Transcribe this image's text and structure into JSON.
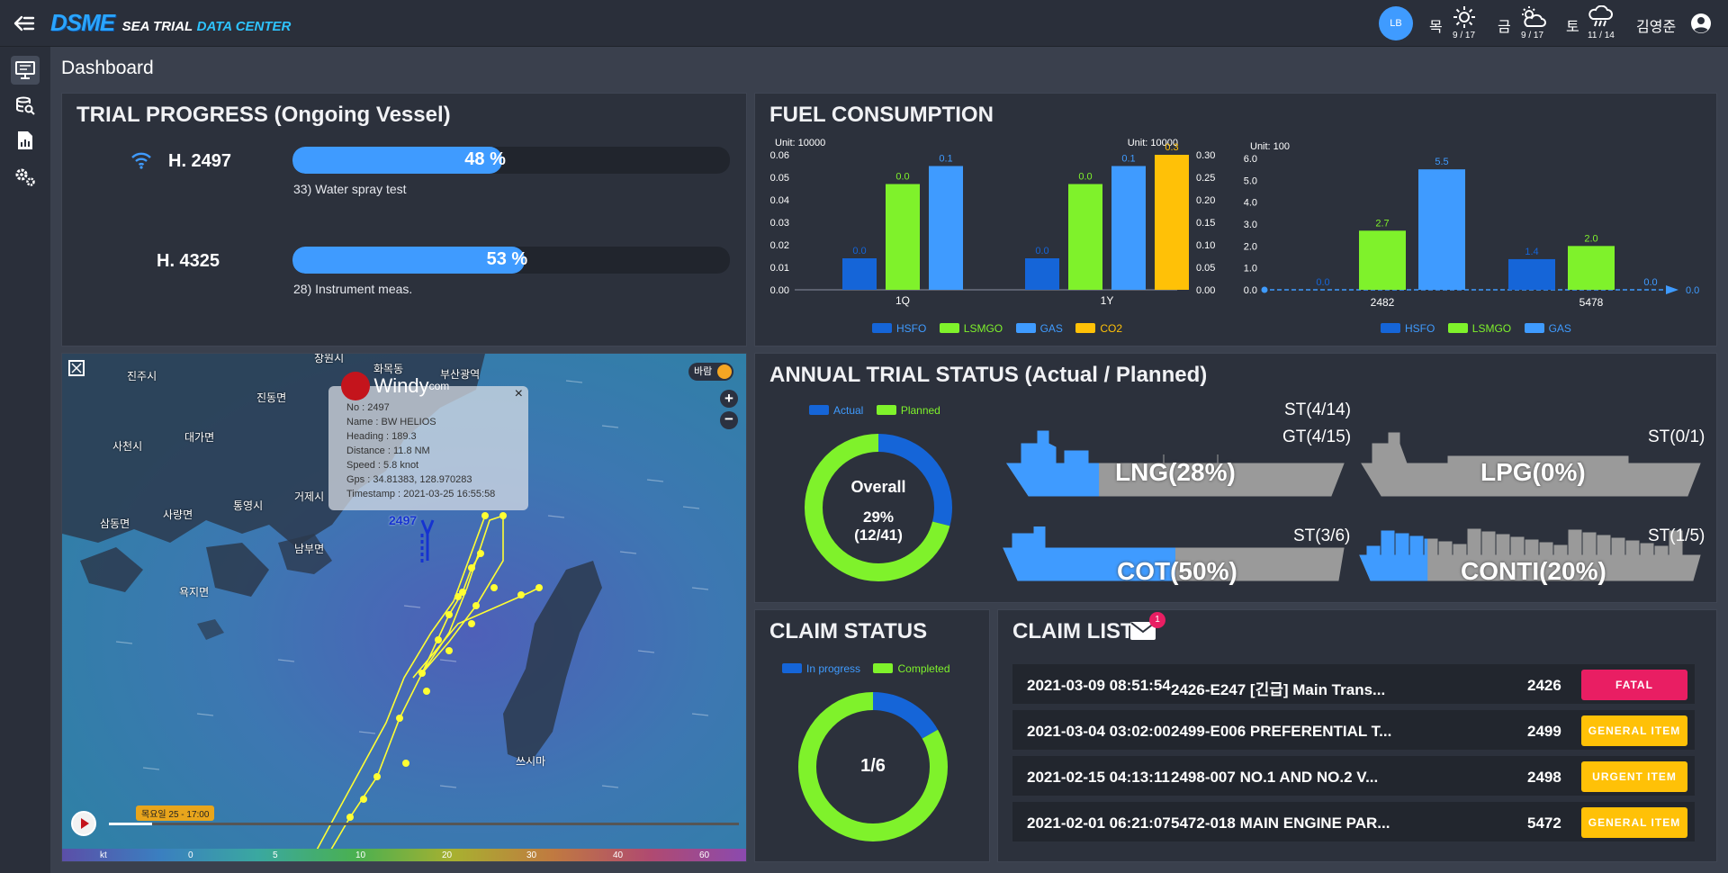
{
  "app": {
    "logo": "DSME",
    "title_part1": "SEA TRIAL",
    "title_part2": "DATA CENTER"
  },
  "header": {
    "avatar": "LB",
    "weather": [
      {
        "day": "목",
        "icon": "sun-icon",
        "value": "9 / 17"
      },
      {
        "day": "금",
        "icon": "partly-cloudy-icon",
        "value": "9 / 17"
      },
      {
        "day": "토",
        "icon": "rain-icon",
        "value": "11 / 14"
      }
    ],
    "user": "김영준"
  },
  "page": {
    "title": "Dashboard"
  },
  "trial_progress": {
    "title": "TRIAL PROGRESS (Ongoing Vessel)",
    "vessels": [
      {
        "name": "H. 2497",
        "percent_label": "48 %",
        "percent": 48,
        "step": "33) Water spray test",
        "live": true
      },
      {
        "name": "H. 4325",
        "percent_label": "53 %",
        "percent": 53,
        "step": "28) Instrument meas.",
        "live": false
      }
    ]
  },
  "fuel": {
    "title": "FUEL CONSUMPTION",
    "legend": [
      "HSFO",
      "LSMGO",
      "GAS",
      "CO2"
    ],
    "legend2": [
      "HSFO",
      "LSMGO",
      "GAS"
    ]
  },
  "chart_data": [
    {
      "type": "bar",
      "unit_left": "Unit: 10000",
      "unit_right": "Unit: 10000",
      "categories": [
        "1Q",
        "1Y"
      ],
      "yticks_left": [
        "0.06",
        "0.05",
        "0.04",
        "0.03",
        "0.02",
        "0.01",
        "0.00"
      ],
      "yticks_right": [
        "0.30",
        "0.25",
        "0.20",
        "0.15",
        "0.10",
        "0.05",
        "0.00"
      ],
      "ylim_left": [
        0,
        0.06
      ],
      "ylim_right": [
        0,
        0.3
      ],
      "series": [
        {
          "name": "HSFO",
          "values": [
            0.014,
            0.014
          ],
          "labels": [
            "0.0",
            "0.0"
          ],
          "color": "#1565d8"
        },
        {
          "name": "LSMGO",
          "values": [
            0.047,
            0.047
          ],
          "labels": [
            "0.0",
            "0.0"
          ],
          "color": "#7ff22b"
        },
        {
          "name": "GAS",
          "values": [
            0.055,
            0.055
          ],
          "labels": [
            "0.1",
            "0.1"
          ],
          "color": "#3f9bff"
        },
        {
          "name": "CO2",
          "values": [
            null,
            0.3
          ],
          "labels": [
            "",
            "0.3"
          ],
          "color": "#ffc107",
          "axis": "right"
        }
      ]
    },
    {
      "type": "bar",
      "unit": "Unit: 100",
      "categories": [
        "2482",
        "5478"
      ],
      "yticks": [
        "6.0",
        "5.0",
        "4.0",
        "3.0",
        "2.0",
        "1.0",
        "0.0"
      ],
      "ylim": [
        0,
        6
      ],
      "series": [
        {
          "name": "HSFO",
          "values": [
            0,
            1.4
          ],
          "labels": [
            "0.0",
            "1.4"
          ],
          "color": "#1565d8"
        },
        {
          "name": "LSMGO",
          "values": [
            2.7,
            2.0
          ],
          "labels": [
            "2.7",
            "2.0"
          ],
          "color": "#7ff22b"
        },
        {
          "name": "GAS",
          "values": [
            5.5,
            0
          ],
          "labels": [
            "5.5",
            "0.0"
          ],
          "color": "#3f9bff"
        }
      ],
      "end_label": "0.0"
    },
    {
      "type": "pie",
      "title": "Overall",
      "center_value": "29%",
      "center_sub": "(12/41)",
      "legend": [
        "Actual",
        "Planned"
      ],
      "values": [
        29,
        71
      ],
      "colors": [
        "#1565d8",
        "#7ff22b"
      ]
    },
    {
      "type": "pie",
      "center_value": "1/6",
      "legend": [
        "In progress",
        "Completed"
      ],
      "values": [
        16.7,
        83.3
      ],
      "colors": [
        "#1565d8",
        "#7ff22b"
      ]
    }
  ],
  "map": {
    "windy_logo": "Windy",
    "windy_suffix": "com",
    "wind_button": "바람",
    "popup": [
      "No : 2497",
      "Name : BW HELIOS",
      "Heading : 189.3",
      "Distance : 11.8 NM",
      "Speed : 5.8 knot",
      "Gps : 34.81383, 128.970283",
      "Timestamp : 2021-03-25 16:55:58"
    ],
    "vessel_label": "2497",
    "places": [
      "창원시",
      "화목동",
      "부산광역",
      "진주시",
      "진동면",
      "사천시",
      "대가면",
      "거제시",
      "통영시",
      "사량면",
      "삼동면",
      "남부면",
      "욕지면",
      "쓰시마"
    ],
    "timeline_label": "목요일 25 - 17:00",
    "scale": [
      "kt",
      "0",
      "5",
      "10",
      "20",
      "30",
      "40",
      "60"
    ]
  },
  "annual": {
    "title": "ANNUAL TRIAL STATUS (Actual / Planned)",
    "ships": [
      {
        "label": "LNG(28%)",
        "percent": 28,
        "st": "ST(4/14)",
        "gt": "GT(4/15)"
      },
      {
        "label": "LPG(0%)",
        "percent": 0,
        "st": "ST(0/1)"
      },
      {
        "label": "COT(50%)",
        "percent": 50,
        "st": "ST(3/6)"
      },
      {
        "label": "CONTI(20%)",
        "percent": 20,
        "st": "ST(1/5)"
      }
    ]
  },
  "claim_status": {
    "title": "CLAIM STATUS"
  },
  "claim_list": {
    "title": "CLAIM LIST",
    "badge_count": "1",
    "rows": [
      {
        "date": "2021-03-09 08:51:54",
        "desc": "2426-E247 [긴급] Main Trans...",
        "hull": "2426",
        "status": "FATAL",
        "color": "#e91e63"
      },
      {
        "date": "2021-03-04 03:02:00",
        "desc": "2499-E006 PREFERENTIAL T...",
        "hull": "2499",
        "status": "GENERAL ITEM",
        "color": "#ffc107"
      },
      {
        "date": "2021-02-15 04:13:11",
        "desc": "2498-007 NO.1 AND NO.2 V...",
        "hull": "2498",
        "status": "URGENT ITEM",
        "color": "#ffc107"
      },
      {
        "date": "2021-02-01 06:21:07",
        "desc": "5472-018 MAIN ENGINE PAR...",
        "hull": "5472",
        "status": "GENERAL ITEM",
        "color": "#ffc107"
      }
    ]
  }
}
